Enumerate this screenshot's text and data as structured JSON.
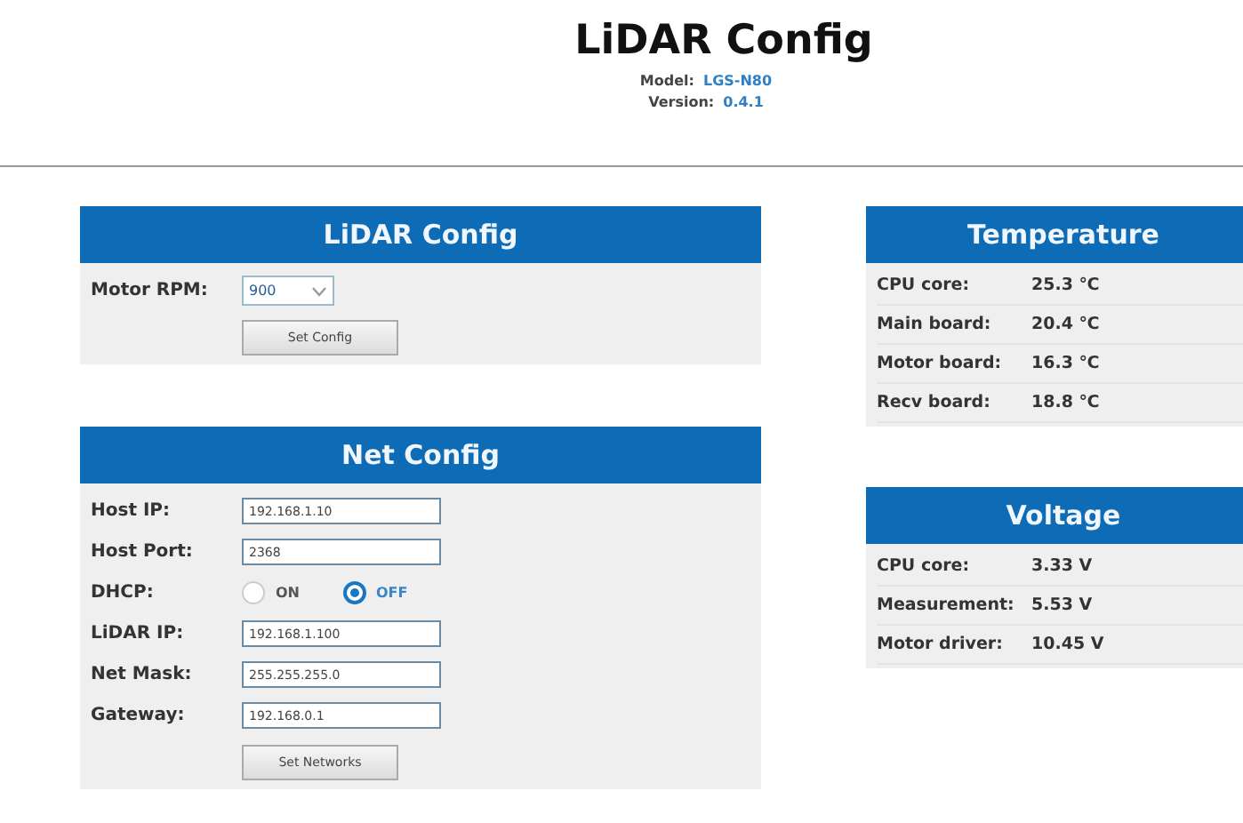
{
  "header": {
    "title": "LiDAR Config",
    "info": [
      {
        "label": "Model:",
        "value": "LGS-N80"
      },
      {
        "label": "Version:",
        "value": "0.4.1"
      }
    ]
  },
  "lidar_config": {
    "title": "LiDAR Config",
    "motor_rpm": {
      "label": "Motor RPM:",
      "value": "900"
    },
    "button": "Set Config"
  },
  "net_config": {
    "title": "Net Config",
    "fields": [
      {
        "kind": "text",
        "label": "Host IP:",
        "value": "192.168.1.10"
      },
      {
        "kind": "text",
        "label": "Host Port:",
        "value": "2368"
      },
      {
        "kind": "radio",
        "label": "DHCP:",
        "options": [
          {
            "label": "ON",
            "selected": false
          },
          {
            "label": "OFF",
            "selected": true
          }
        ]
      },
      {
        "kind": "text",
        "label": "LiDAR IP:",
        "value": "192.168.1.100"
      },
      {
        "kind": "text",
        "label": "Net Mask:",
        "value": "255.255.255.0"
      },
      {
        "kind": "text",
        "label": "Gateway:",
        "value": "192.168.0.1"
      }
    ],
    "button": "Set Networks"
  },
  "temperature": {
    "title": "Temperature",
    "rows": [
      {
        "label": "CPU core:",
        "value": "25.3 ℃"
      },
      {
        "label": "Main board:",
        "value": "20.4 ℃"
      },
      {
        "label": "Motor board:",
        "value": "16.3 ℃"
      },
      {
        "label": "Recv board:",
        "value": "18.8 ℃"
      }
    ]
  },
  "voltage": {
    "title": "Voltage",
    "rows": [
      {
        "label": "CPU core:",
        "value": "3.33 V"
      },
      {
        "label": "Measurement:",
        "value": "5.53 V"
      },
      {
        "label": "Motor driver:",
        "value": "10.45 V"
      }
    ]
  }
}
